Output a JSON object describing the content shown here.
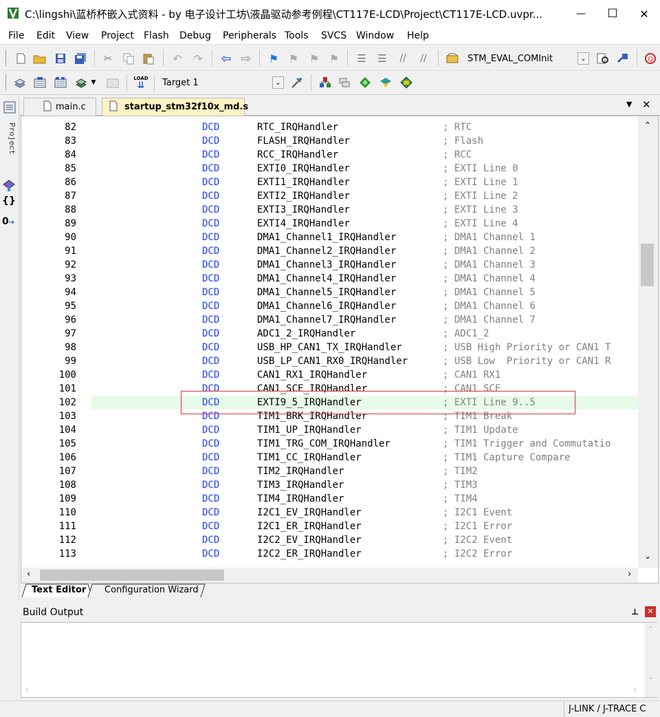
{
  "window": {
    "title": "C:\\lingshi\\蓝桥杯嵌入式资料 - by 电子设计工坊\\液晶驱动参考例程\\CT117E-LCD\\Project\\CT117E-LCD.uvpr...",
    "minimize": "—",
    "maximize": "☐",
    "close": "✕"
  },
  "menu": [
    "File",
    "Edit",
    "View",
    "Project",
    "Flash",
    "Debug",
    "Peripherals",
    "Tools",
    "SVCS",
    "Window",
    "Help"
  ],
  "toolbar": {
    "function_combo": "STM_EVAL_COMInit",
    "load_label": "LOAD",
    "target_combo": "Target 1"
  },
  "left_panel": {
    "project_label": "Project",
    "braces": "{}",
    "templates": "0"
  },
  "tabs": [
    {
      "label": "main.c",
      "active": false
    },
    {
      "label": "startup_stm32f10x_md.s",
      "active": true
    }
  ],
  "tab_controls": {
    "menu": "▼",
    "close": "✕"
  },
  "code": {
    "lines": [
      {
        "num": "82",
        "kw": "DCD",
        "sym": "RTC_IRQHandler",
        "cmt": "; RTC"
      },
      {
        "num": "83",
        "kw": "DCD",
        "sym": "FLASH_IRQHandler",
        "cmt": "; Flash"
      },
      {
        "num": "84",
        "kw": "DCD",
        "sym": "RCC_IRQHandler",
        "cmt": "; RCC"
      },
      {
        "num": "85",
        "kw": "DCD",
        "sym": "EXTI0_IRQHandler",
        "cmt": "; EXTI Line 0"
      },
      {
        "num": "86",
        "kw": "DCD",
        "sym": "EXTI1_IRQHandler",
        "cmt": "; EXTI Line 1"
      },
      {
        "num": "87",
        "kw": "DCD",
        "sym": "EXTI2_IRQHandler",
        "cmt": "; EXTI Line 2"
      },
      {
        "num": "88",
        "kw": "DCD",
        "sym": "EXTI3_IRQHandler",
        "cmt": "; EXTI Line 3"
      },
      {
        "num": "89",
        "kw": "DCD",
        "sym": "EXTI4_IRQHandler",
        "cmt": "; EXTI Line 4"
      },
      {
        "num": "90",
        "kw": "DCD",
        "sym": "DMA1_Channel1_IRQHandler",
        "cmt": "; DMA1 Channel 1"
      },
      {
        "num": "91",
        "kw": "DCD",
        "sym": "DMA1_Channel2_IRQHandler",
        "cmt": "; DMA1 Channel 2"
      },
      {
        "num": "92",
        "kw": "DCD",
        "sym": "DMA1_Channel3_IRQHandler",
        "cmt": "; DMA1 Channel 3"
      },
      {
        "num": "93",
        "kw": "DCD",
        "sym": "DMA1_Channel4_IRQHandler",
        "cmt": "; DMA1 Channel 4"
      },
      {
        "num": "94",
        "kw": "DCD",
        "sym": "DMA1_Channel5_IRQHandler",
        "cmt": "; DMA1 Channel 5"
      },
      {
        "num": "95",
        "kw": "DCD",
        "sym": "DMA1_Channel6_IRQHandler",
        "cmt": "; DMA1 Channel 6"
      },
      {
        "num": "96",
        "kw": "DCD",
        "sym": "DMA1_Channel7_IRQHandler",
        "cmt": "; DMA1 Channel 7"
      },
      {
        "num": "97",
        "kw": "DCD",
        "sym": "ADC1_2_IRQHandler",
        "cmt": "; ADC1_2"
      },
      {
        "num": "98",
        "kw": "DCD",
        "sym": "USB_HP_CAN1_TX_IRQHandler",
        "cmt": "; USB High Priority or CAN1 T"
      },
      {
        "num": "99",
        "kw": "DCD",
        "sym": "USB_LP_CAN1_RX0_IRQHandler",
        "cmt": "; USB Low  Priority or CAN1 R"
      },
      {
        "num": "100",
        "kw": "DCD",
        "sym": "CAN1_RX1_IRQHandler",
        "cmt": "; CAN1 RX1"
      },
      {
        "num": "101",
        "kw": "DCD",
        "sym": "CAN1_SCE_IRQHandler",
        "cmt": "; CAN1 SCE"
      },
      {
        "num": "102",
        "kw": "DCD",
        "sym": "EXTI9_5_IRQHandler",
        "cmt": "; EXTI Line 9..5"
      },
      {
        "num": "103",
        "kw": "DCD",
        "sym": "TIM1_BRK_IRQHandler",
        "cmt": "; TIM1 Break"
      },
      {
        "num": "104",
        "kw": "DCD",
        "sym": "TIM1_UP_IRQHandler",
        "cmt": "; TIM1 Update"
      },
      {
        "num": "105",
        "kw": "DCD",
        "sym": "TIM1_TRG_COM_IRQHandler",
        "cmt": "; TIM1 Trigger and Commutatio"
      },
      {
        "num": "106",
        "kw": "DCD",
        "sym": "TIM1_CC_IRQHandler",
        "cmt": "; TIM1 Capture Compare"
      },
      {
        "num": "107",
        "kw": "DCD",
        "sym": "TIM2_IRQHandler",
        "cmt": "; TIM2"
      },
      {
        "num": "108",
        "kw": "DCD",
        "sym": "TIM3_IRQHandler",
        "cmt": "; TIM3"
      },
      {
        "num": "109",
        "kw": "DCD",
        "sym": "TIM4_IRQHandler",
        "cmt": "; TIM4"
      },
      {
        "num": "110",
        "kw": "DCD",
        "sym": "I2C1_EV_IRQHandler",
        "cmt": "; I2C1 Event"
      },
      {
        "num": "111",
        "kw": "DCD",
        "sym": "I2C1_ER_IRQHandler",
        "cmt": "; I2C1 Error"
      },
      {
        "num": "112",
        "kw": "DCD",
        "sym": "I2C2_EV_IRQHandler",
        "cmt": "; I2C2 Event"
      },
      {
        "num": "113",
        "kw": "DCD",
        "sym": "I2C2_ER_IRQHandler",
        "cmt": "; I2C2 Error"
      }
    ],
    "highlighted_line": "102",
    "highlight_color": "#e8fbe8",
    "annotation_color": "#d9363e"
  },
  "bottom_tabs": [
    "Text Editor",
    "Configuration Wizard"
  ],
  "build_output": {
    "title": "Build Output",
    "pin": "⊥",
    "close": "✕"
  },
  "status_bar": {
    "debugger": "J-LINK / J-TRACE C"
  }
}
